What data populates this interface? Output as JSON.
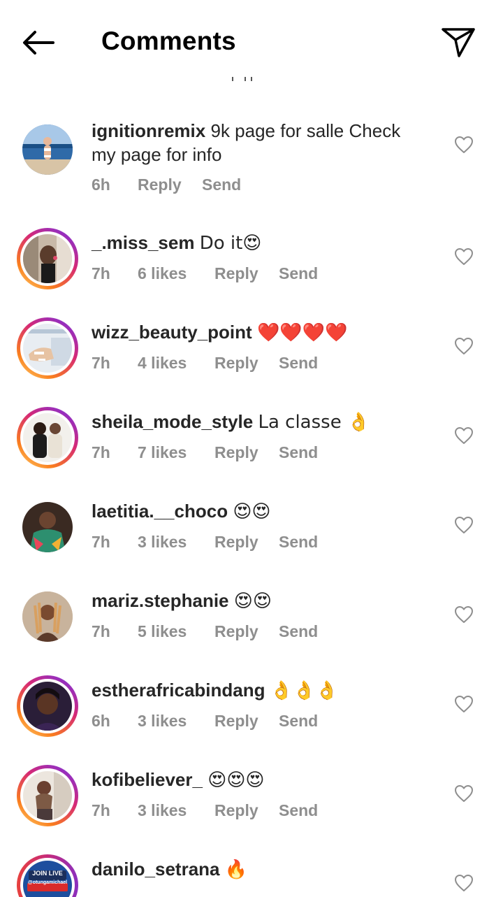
{
  "header": {
    "title": "Comments"
  },
  "comments": [
    {
      "username": "ignitionremix",
      "text": "9k page for salle Check my page for info",
      "time": "6h",
      "likes": "",
      "reply": "Reply",
      "send": "Send"
    },
    {
      "username": "_.miss_sem",
      "text": "Do it😍",
      "time": "7h",
      "likes": "6 likes",
      "reply": "Reply",
      "send": "Send"
    },
    {
      "username": "wizz_beauty_point",
      "text": "❤️❤️❤️❤️",
      "time": "7h",
      "likes": "4 likes",
      "reply": "Reply",
      "send": "Send"
    },
    {
      "username": "sheila_mode_style",
      "text": "La classe 👌",
      "time": "7h",
      "likes": "7 likes",
      "reply": "Reply",
      "send": "Send"
    },
    {
      "username": "laetitia.__choco",
      "text": "😍😍",
      "time": "7h",
      "likes": "3 likes",
      "reply": "Reply",
      "send": "Send"
    },
    {
      "username": "mariz.stephanie",
      "text": "😍😍",
      "time": "7h",
      "likes": "5 likes",
      "reply": "Reply",
      "send": "Send"
    },
    {
      "username": "estherafricabindang",
      "text": "👌👌👌",
      "time": "6h",
      "likes": "3 likes",
      "reply": "Reply",
      "send": "Send"
    },
    {
      "username": "kofibeliever_",
      "text": "😍😍😍",
      "time": "7h",
      "likes": "3 likes",
      "reply": "Reply",
      "send": "Send"
    },
    {
      "username": "danilo_setrana",
      "text": "🔥",
      "time": "",
      "likes": "",
      "reply": "",
      "send": ""
    }
  ],
  "live_badge": {
    "label": "JOIN LIVE",
    "handle": "@otungamichael"
  },
  "colors": {
    "text": "#262626",
    "meta": "#8e8e8e",
    "ring_start": "#feda75",
    "ring_mid": "#d62976",
    "ring_end": "#962fbf"
  }
}
